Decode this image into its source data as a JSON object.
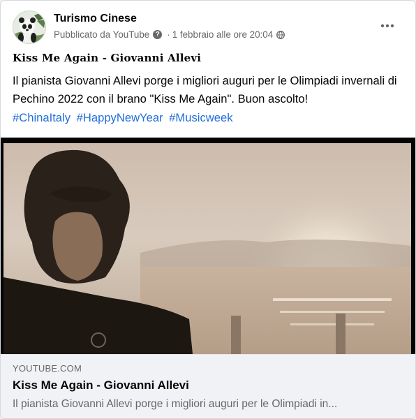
{
  "post": {
    "page_name": "Turismo Cinese",
    "source": "Pubblicato da YouTube",
    "separator": "·",
    "date": "1 febbraio alle ore 20:04",
    "title": "Kiss Me Again - Giovanni Allevi",
    "description": "Il pianista Giovanni Allevi porge i migliori auguri per le Olimpiadi invernali di Pechino 2022 con il brano \"Kiss Me Again\". Buon ascolto!",
    "hashtags": [
      "#ChinaItaly",
      "#HappyNewYear",
      "#Musicweek"
    ],
    "icons": {
      "avatar": "panda-avatar",
      "help": "question-icon",
      "privacy": "globe-icon",
      "more": "more-options-icon"
    }
  },
  "link_preview": {
    "domain": "YOUTUBE.COM",
    "title": "Kiss Me Again - Giovanni Allevi",
    "description": "Il pianista Giovanni Allevi porge i migliori auguri per le Olimpiadi in..."
  },
  "colors": {
    "link_blue": "#216fdb",
    "secondary_text": "#65676b",
    "primary_text": "#050505"
  }
}
